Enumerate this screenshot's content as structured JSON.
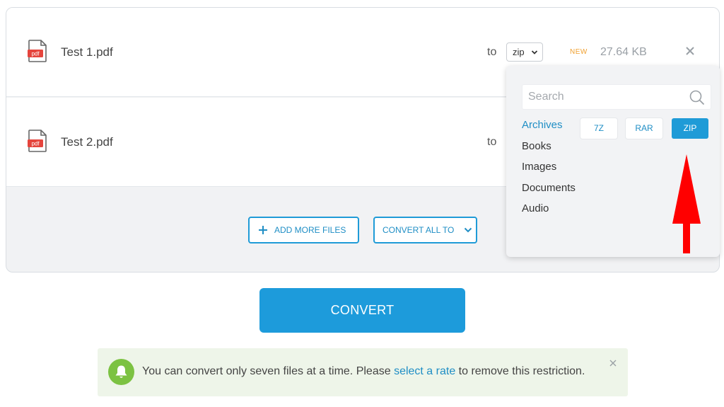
{
  "files": [
    {
      "name": "Test 1.pdf",
      "icon_label": "pdf",
      "to_label": "to",
      "format": "zip",
      "badge": "NEW",
      "size": "27.64 KB"
    },
    {
      "name": "Test 2.pdf",
      "icon_label": "pdf",
      "to_label": "to"
    }
  ],
  "actions": {
    "add_more": "ADD MORE FILES",
    "convert_all": "CONVERT ALL TO"
  },
  "dropdown": {
    "search_placeholder": "Search",
    "categories": [
      "Archives",
      "Books",
      "Images",
      "Documents",
      "Audio"
    ],
    "active_category": "Archives",
    "formats": [
      "7Z",
      "RAR",
      "ZIP"
    ],
    "selected_format": "ZIP"
  },
  "convert_button": "CONVERT",
  "notice": {
    "text_before": "You can convert only seven files at a time. Please ",
    "link_text": "select a rate",
    "text_after": " to remove this restriction."
  },
  "colors": {
    "accent": "#1f9bd7",
    "badge": "#f0a030",
    "notice_bg": "#eef5e9",
    "bell": "#7cc242",
    "annotation_arrow": "#ff0000"
  }
}
